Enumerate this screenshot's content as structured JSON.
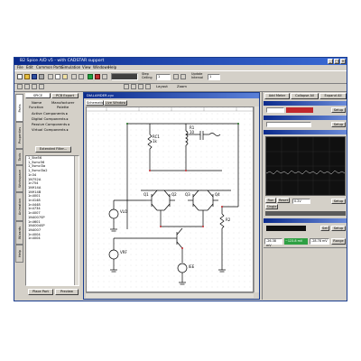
{
  "window": {
    "title": "B2 Spice A/D v5 - with CADSTAR support",
    "minimize": "_",
    "maximize": "□",
    "close": "×"
  },
  "menu": [
    "File",
    "Edit",
    "Common Parts",
    "Simulation",
    "View",
    "Windows",
    "Help"
  ],
  "toolbar": {
    "step_ceiling_label": "Step Ceiling",
    "step_value": "1",
    "update_interval_label": "Update Interval",
    "update_value": "1",
    "layout_label": "Layout",
    "zoom_label": "Zoom"
  },
  "parts_panel": {
    "tab_spice": "SPICE",
    "tab_pcb": "PCB Export",
    "col_name": "Name",
    "col_manufacturer": "Manufacturer",
    "col_function": "Function",
    "col_palette": "Palette",
    "categories": [
      "Active Components",
      "Digital Components",
      "Passive Components",
      "Virtual Components"
    ],
    "extended_filter": "Extended Filter...",
    "parts": [
      "1_5ke56",
      "1_5smc56",
      "1_5smcl3a",
      "1_5smcl3a2",
      "1n34",
      "1N752A",
      "1n754",
      "1N914A",
      "1N914B",
      "1n4001",
      "1n4148",
      "1n4448",
      "1n4734",
      "1n4007",
      "1N4007SP",
      "1n4601",
      "1N4004SP",
      "1N4007",
      "1n4004",
      "1n4004"
    ],
    "place_part": "Place Part",
    "preview": "Preview",
    "side_tabs": [
      "Parts",
      "Properties",
      "Tools",
      "Workspace",
      "Animation",
      "Wizards",
      "Help"
    ]
  },
  "schematic": {
    "window_title": "DIALAMDER.cyc",
    "tab_schematic": "Schematic",
    "tab_live_window": "Live Window",
    "labels": [
      "RC1",
      "1k",
      "R1",
      "10",
      "Q1",
      "Q2",
      "Q3",
      "Q4",
      "VLO",
      "VRF",
      "R2",
      "IEE"
    ]
  },
  "right_panel": {
    "add_meter": "Add Meter",
    "collapse_all": "Collapse All",
    "expand_all": "Expand All",
    "meter1_setup": "Setup",
    "meter2_setup": "Setup",
    "scope_setup": "Setup",
    "scope_run": "Run",
    "scope_reset": "Reset",
    "scope_single": "Single",
    "vdiv_value": "0.2V",
    "lower_setup": "Setup",
    "lower_set": "Set",
    "readout1": "-26.38 mV",
    "readout2": "~123.8 mV",
    "readout3": "-28.78 mV",
    "range_label": "Range"
  },
  "colors": {
    "title_bar": "#0a2a8c",
    "canvas": "#ffffff",
    "scope_bg": "#101010",
    "readout_green": "#2ea043",
    "meter_red": "#c0282d"
  }
}
